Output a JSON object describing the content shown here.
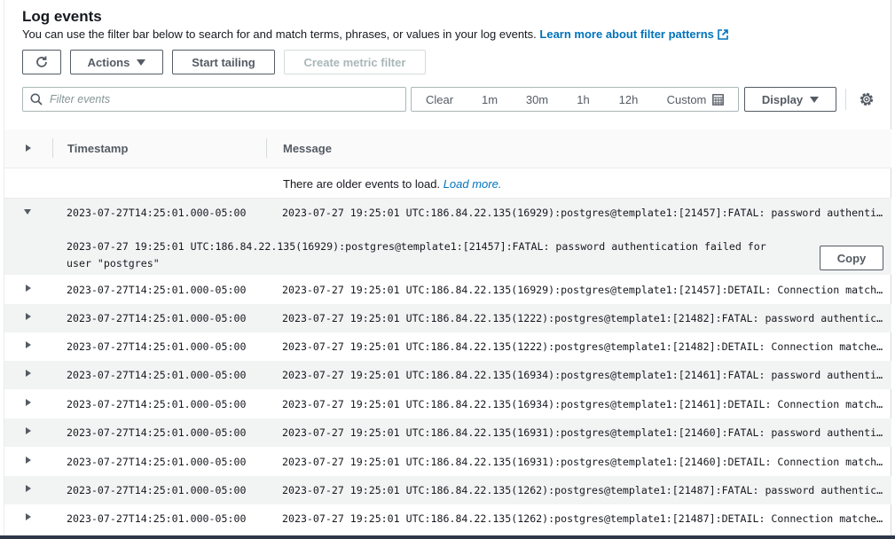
{
  "header": {
    "title": "Log events",
    "description": "You can use the filter bar below to search for and match terms, phrases, or values in your log events.",
    "learn_more": "Learn more about filter patterns"
  },
  "toolbar": {
    "refresh_icon": "refresh-icon",
    "actions_label": "Actions",
    "start_tailing_label": "Start tailing",
    "create_metric_filter_label": "Create metric filter"
  },
  "filter": {
    "placeholder": "Filter events",
    "time_options": [
      "Clear",
      "1m",
      "30m",
      "1h",
      "12h",
      "Custom"
    ],
    "display_label": "Display"
  },
  "table": {
    "columns": [
      "Timestamp",
      "Message"
    ],
    "older_text": "There are older events to load.",
    "load_more": "Load more.",
    "expanded": {
      "timestamp": "2023-07-27T14:25:01.000-05:00",
      "message": "2023-07-27 19:25:01 UTC:186.84.22.135(16929):postgres@template1:[21457]:FATAL: password authentication failed for user \"postgres\"",
      "full_text": "2023-07-27 19:25:01 UTC:186.84.22.135(16929):postgres@template1:[21457]:FATAL:  password authentication failed for user \"postgres\"",
      "copy_label": "Copy"
    },
    "rows": [
      {
        "timestamp": "2023-07-27T14:25:01.000-05:00",
        "message": "2023-07-27 19:25:01 UTC:186.84.22.135(16929):postgres@template1:[21457]:DETAIL: Connection matched pg_hba.conf line"
      },
      {
        "timestamp": "2023-07-27T14:25:01.000-05:00",
        "message": "2023-07-27 19:25:01 UTC:186.84.22.135(1222):postgres@template1:[21482]:FATAL: password authentication failed"
      },
      {
        "timestamp": "2023-07-27T14:25:01.000-05:00",
        "message": "2023-07-27 19:25:01 UTC:186.84.22.135(1222):postgres@template1:[21482]:DETAIL: Connection matched pg_hba.conf"
      },
      {
        "timestamp": "2023-07-27T14:25:01.000-05:00",
        "message": "2023-07-27 19:25:01 UTC:186.84.22.135(16934):postgres@template1:[21461]:FATAL: password authentication failed"
      },
      {
        "timestamp": "2023-07-27T14:25:01.000-05:00",
        "message": "2023-07-27 19:25:01 UTC:186.84.22.135(16934):postgres@template1:[21461]:DETAIL: Connection matched pg_hba.conf"
      },
      {
        "timestamp": "2023-07-27T14:25:01.000-05:00",
        "message": "2023-07-27 19:25:01 UTC:186.84.22.135(16931):postgres@template1:[21460]:FATAL: password authentication failed"
      },
      {
        "timestamp": "2023-07-27T14:25:01.000-05:00",
        "message": "2023-07-27 19:25:01 UTC:186.84.22.135(16931):postgres@template1:[21460]:DETAIL: Connection matched pg_hba.conf"
      },
      {
        "timestamp": "2023-07-27T14:25:01.000-05:00",
        "message": "2023-07-27 19:25:01 UTC:186.84.22.135(1262):postgres@template1:[21487]:FATAL: password authentication failed"
      },
      {
        "timestamp": "2023-07-27T14:25:01.000-05:00",
        "message": "2023-07-27 19:25:01 UTC:186.84.22.135(1262):postgres@template1:[21487]:DETAIL: Connection matched pg_hba.conf"
      }
    ]
  },
  "colors": {
    "link": "#0073bb",
    "text": "#16191f",
    "muted": "#545b64",
    "row_alt": "#f2f3f3"
  }
}
